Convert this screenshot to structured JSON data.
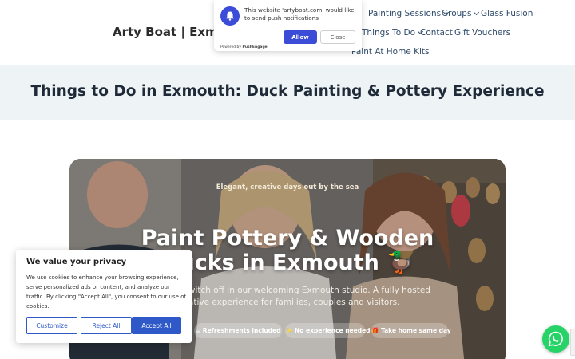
{
  "header": {
    "site_title": "Arty Boat | Exmou",
    "nav": {
      "painting_sessions": "Painting Sessions",
      "groups": "Groups",
      "glass_fusion": "Glass Fusion",
      "things_to_do": "Things To Do",
      "contact": "Contact",
      "gift_vouchers": "Gift Vouchers",
      "paint_at_home_kits": "Paint At Home Kits"
    }
  },
  "push_notification": {
    "message": "This website 'artyboat.com' would like to send push notifications",
    "allow_label": "Allow",
    "close_label": "Close",
    "powered_by": "Powered by",
    "powered_brand": "PushEngage",
    "icon": "bell-icon",
    "accent_color": "#3b4cd6"
  },
  "page": {
    "title": "Things to Do in Exmouth: Duck Painting & Pottery Experience"
  },
  "hero": {
    "tagline": "Elegant, creative days out by the sea",
    "heading_line1": "Paint Pottery & Wooden",
    "heading_line2": "Ducks in Exmouth 🦆",
    "subtitle_line1": "chat and switch off in our welcoming Exmouth studio. A fully hosted",
    "subtitle_line2": "creative experience for families, couples and visitors.",
    "pills": [
      "☕ Refreshments included",
      "✨ No experience needed",
      "🎁 Take home same day"
    ]
  },
  "cookie_banner": {
    "title": "We value your privacy",
    "text": "We use cookies to enhance your browsing experience, serve personalized ads or content, and analyze our traffic. By clicking \"Accept All\", you consent to our use of cookies.",
    "customize_label": "Customize",
    "reject_label": "Reject All",
    "accept_label": "Accept All",
    "accent_color": "#2f58c9"
  },
  "whatsapp": {
    "icon": "whatsapp-icon",
    "color": "#25d366"
  }
}
